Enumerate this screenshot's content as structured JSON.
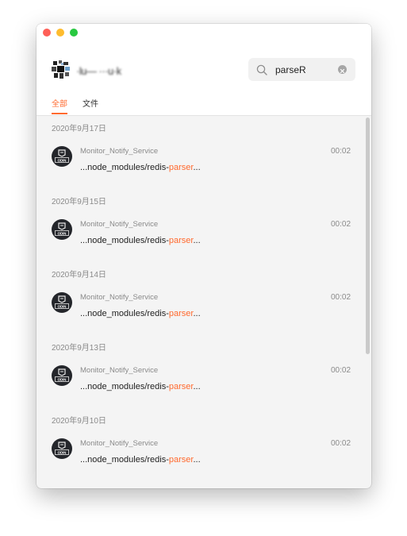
{
  "app": {
    "header": {
      "chat_name": "·lu―  ···u·k"
    },
    "search": {
      "value": "parseR",
      "placeholder": ""
    },
    "tabs": [
      {
        "label": "全部",
        "active": true
      },
      {
        "label": "文件",
        "active": false
      }
    ],
    "accent_color": "#ff6a2f"
  },
  "results": [
    {
      "date": "2020年9月17日",
      "sender": "Monitor_Notify_Service",
      "time": "00:02",
      "snippet_before": "...node_modules/redis-",
      "snippet_match": "parser",
      "snippet_after": "..."
    },
    {
      "date": "2020年9月15日",
      "sender": "Monitor_Notify_Service",
      "time": "00:02",
      "snippet_before": "...node_modules/redis-",
      "snippet_match": "parser",
      "snippet_after": "..."
    },
    {
      "date": "2020年9月14日",
      "sender": "Monitor_Notify_Service",
      "time": "00:02",
      "snippet_before": "...node_modules/redis-",
      "snippet_match": "parser",
      "snippet_after": "..."
    },
    {
      "date": "2020年9月13日",
      "sender": "Monitor_Notify_Service",
      "time": "00:02",
      "snippet_before": "...node_modules/redis-",
      "snippet_match": "parser",
      "snippet_after": "..."
    },
    {
      "date": "2020年9月10日",
      "sender": "Monitor_Notify_Service",
      "time": "00:02",
      "snippet_before": "...node_modules/redis-",
      "snippet_match": "parser",
      "snippet_after": "..."
    }
  ]
}
